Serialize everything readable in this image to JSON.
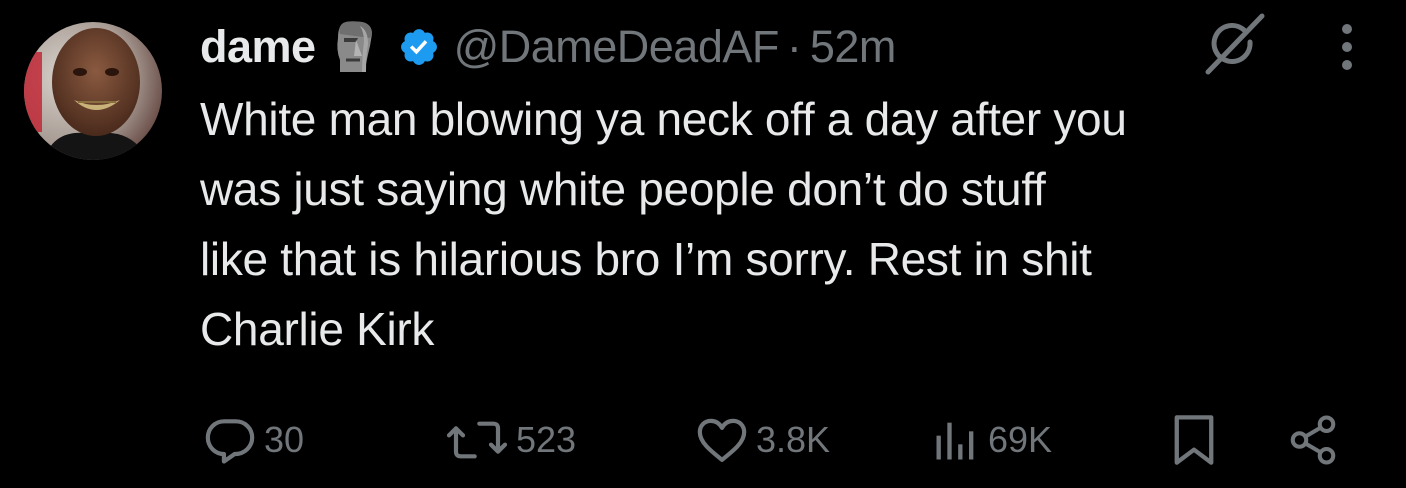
{
  "tweet": {
    "author_name": "dame",
    "name_emoji_icon": "moai-icon",
    "verified_icon": "verified-badge-icon",
    "handle": "@DameDeadAF",
    "separator": "·",
    "timestamp": "52m",
    "text": "White man blowing ya neck off a day after you\nwas just saying white people don’t do stuff\nlike that is hilarious bro I’m sorry. Rest in shit\nCharlie Kirk"
  },
  "top_actions": {
    "grok_icon": "grok-icon",
    "more_icon": "more-vertical-icon"
  },
  "actions": {
    "replies": "30",
    "reposts": "523",
    "likes": "3.8K",
    "views": "69K"
  },
  "colors": {
    "background": "#000000",
    "text": "#e7e9ea",
    "secondary": "#71767b",
    "verified": "#1d9bf0"
  }
}
